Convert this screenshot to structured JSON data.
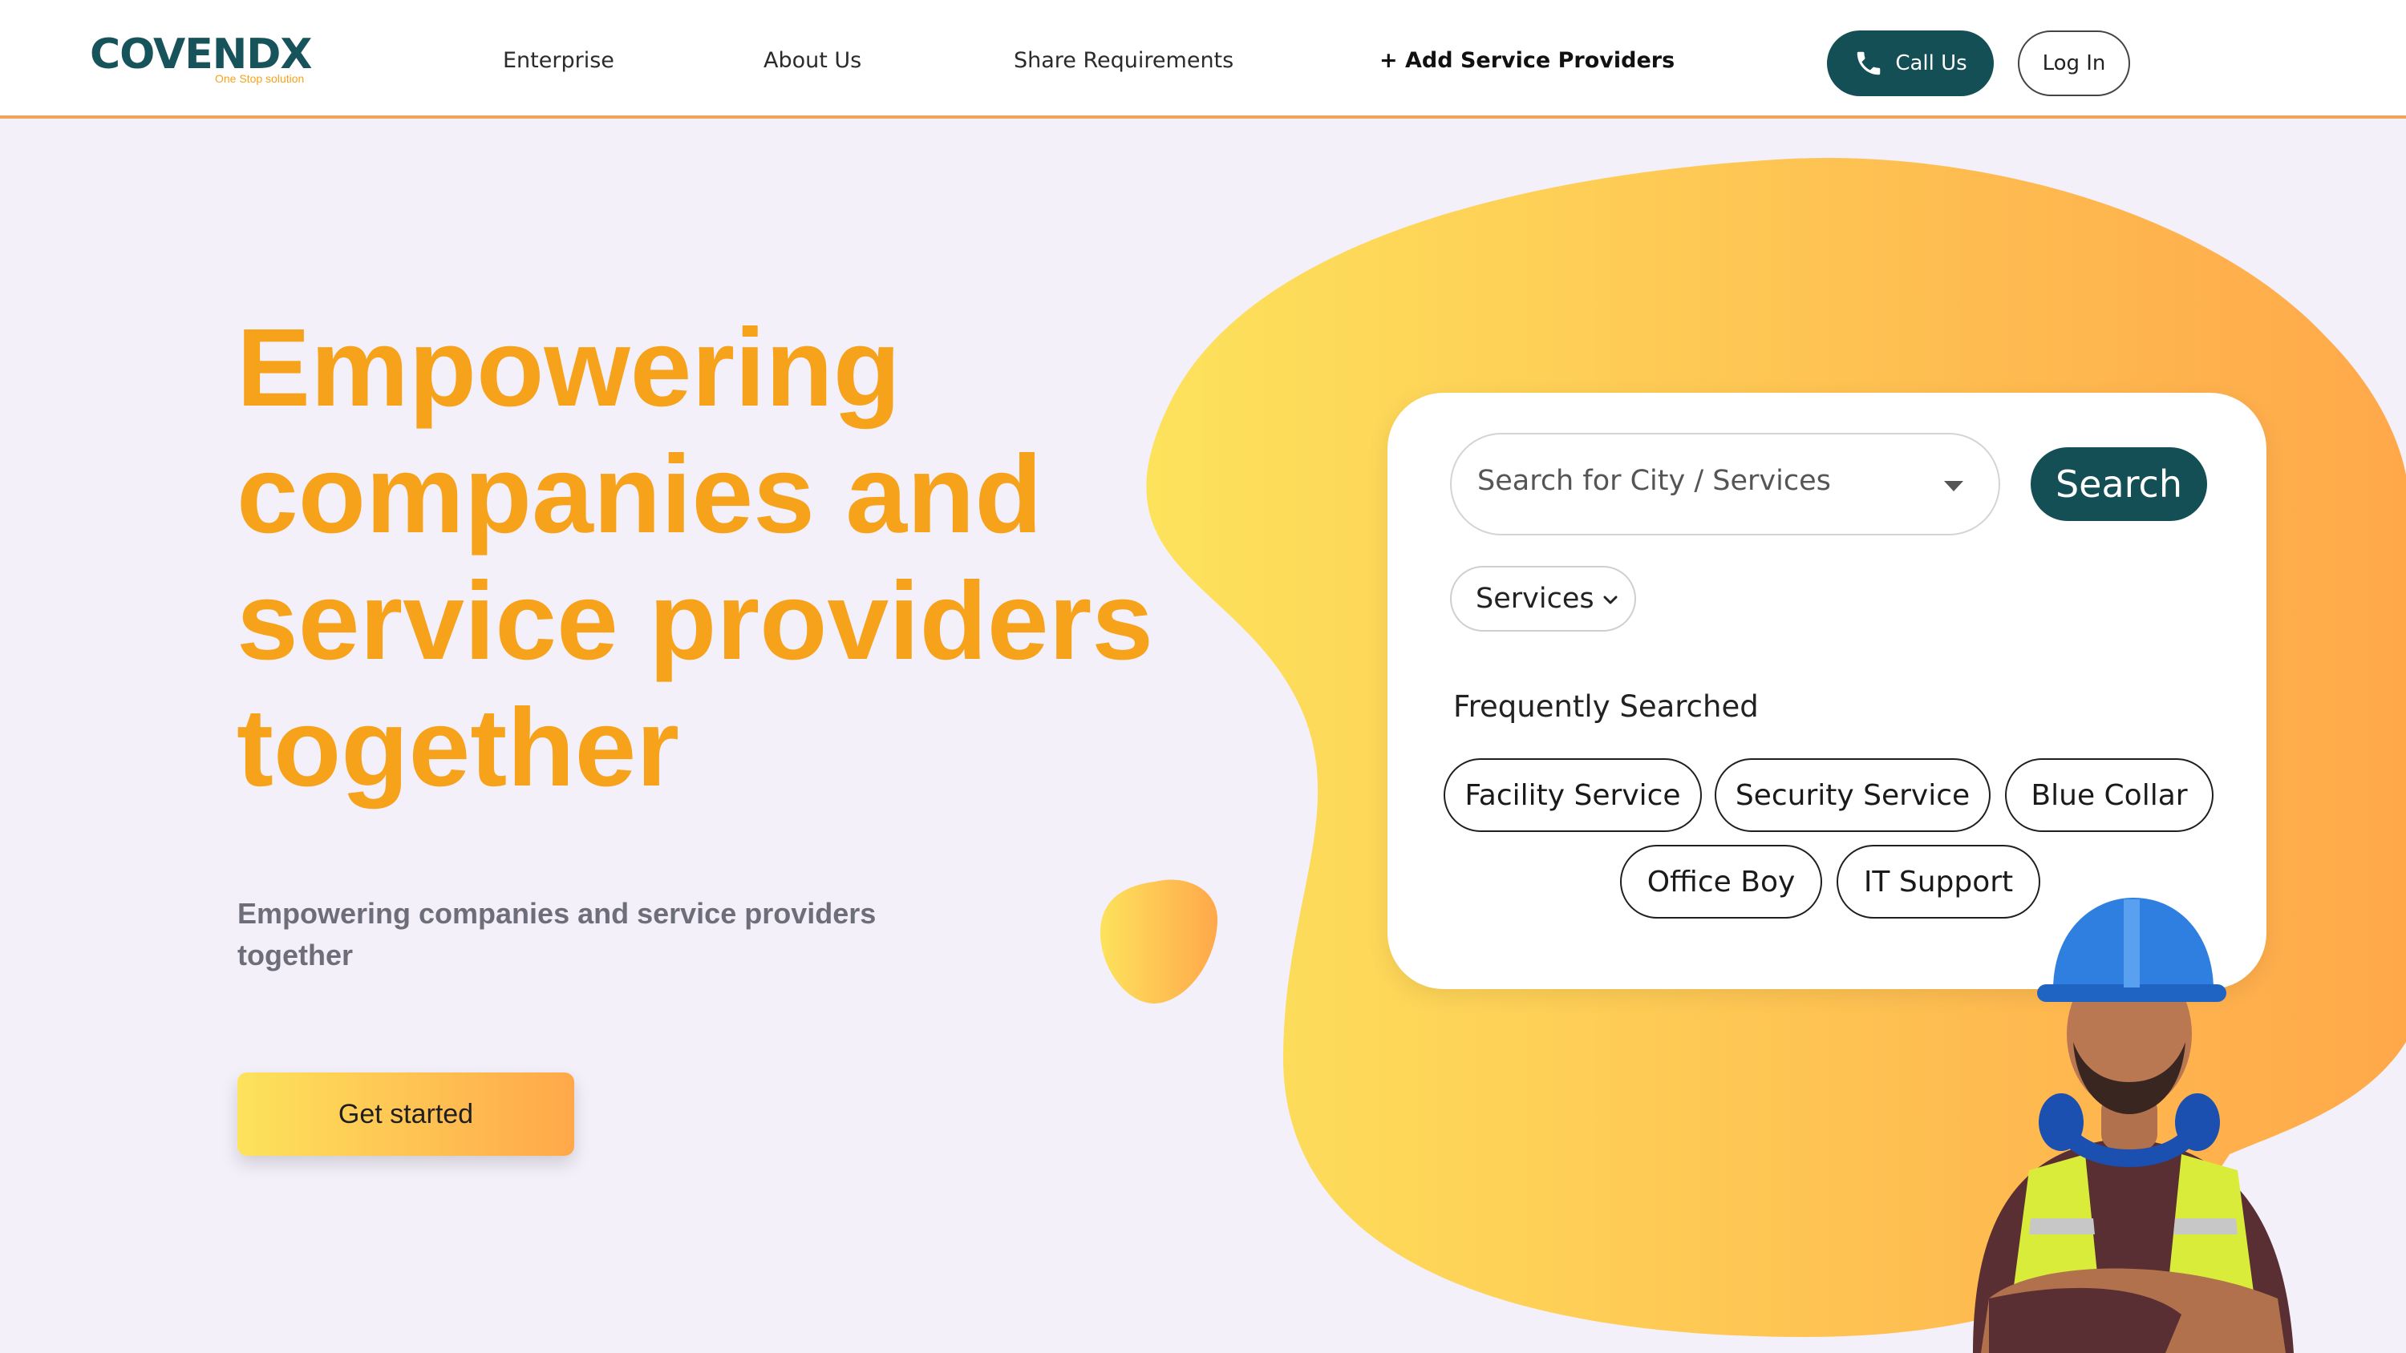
{
  "nav": {
    "logo_main": "COVENDX",
    "logo_tagline": "One Stop solution",
    "links": [
      "Enterprise",
      "About Us",
      "Share Requirements",
      "+ Add Service Providers"
    ],
    "call_label": "Call Us",
    "login_label": "Log In"
  },
  "hero": {
    "title": "Empowering companies and service providers together",
    "subtitle": "Empowering companies and service providers together",
    "cta_label": "Get started"
  },
  "search_card": {
    "search_placeholder": "Search for City / Services",
    "search_button": "Search",
    "category_select": "Services",
    "frequent_label": "Frequently Searched",
    "chips": [
      "Facility Service",
      "Security Service",
      "Blue Collar",
      "Office Boy",
      "IT Support"
    ]
  },
  "colors": {
    "accent_orange": "#f7a21b",
    "brand_teal": "#134f55",
    "background": "#f4f0fa",
    "blob_gradient_start": "#fde25c",
    "blob_gradient_end": "#ffa84a"
  },
  "icons": {
    "call_button": "phone-icon",
    "search_dropdown": "caret-down-icon",
    "category_select": "chevron-down-icon"
  }
}
